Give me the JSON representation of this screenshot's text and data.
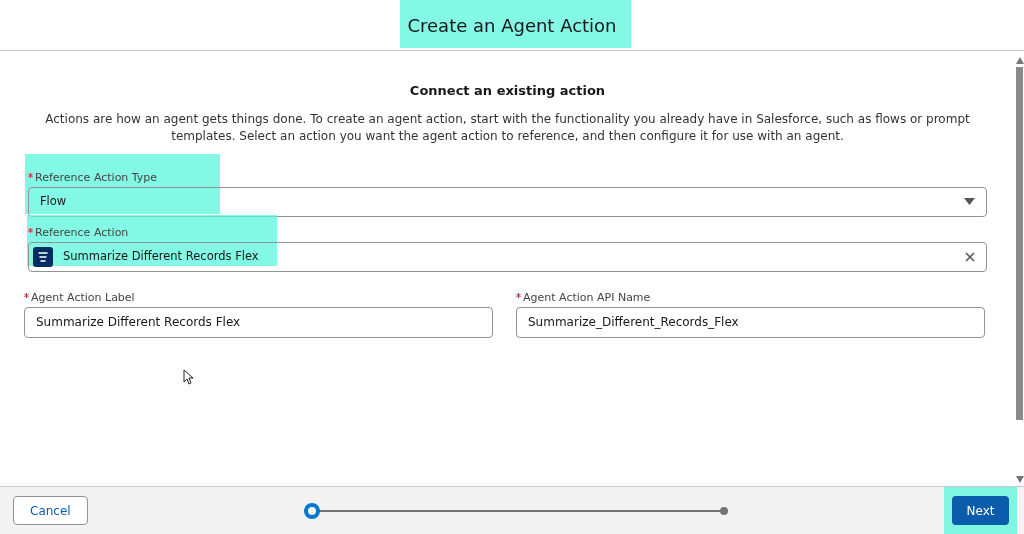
{
  "window": {
    "title": "Create an Agent Action",
    "highlighted": true
  },
  "section": {
    "heading": "Connect an existing action",
    "description": "Actions are how an agent gets things done. To create an agent action, start with the functionality you already have in Salesforce, such as flows or prompt templates. Select an action you want the agent action to reference, and then configure it for use with an agent."
  },
  "fields": [
    {
      "kind": "select",
      "label": "Reference Action Type",
      "required": true,
      "value": "Flow",
      "highlighted": true
    },
    {
      "kind": "lookup",
      "label": "Reference Action",
      "required": true,
      "value": "Summarize Different Records Flex",
      "highlighted": true
    }
  ],
  "row_fields": [
    {
      "label": "Agent Action Label",
      "required": true,
      "value": "Summarize Different Records Flex"
    },
    {
      "label": "Agent Action API Name",
      "required": true,
      "value": "Summarize_Different_Records_Flex"
    }
  ],
  "footer": {
    "cancel": "Cancel",
    "next": {
      "label": "Next",
      "highlighted": true
    },
    "steps": [
      {
        "current": true
      },
      {
        "current": false
      }
    ]
  }
}
